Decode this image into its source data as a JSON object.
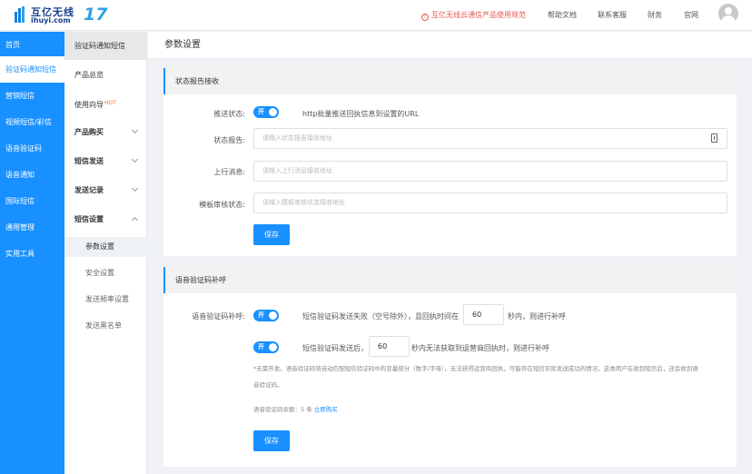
{
  "header": {
    "logo_cn": "互亿无线",
    "logo_en": "ihuyi.com",
    "logo_num": "17",
    "notice": "互亿无线云通信产品使用规范",
    "links": [
      "帮助文档",
      "联系客服",
      "财务",
      "官网"
    ]
  },
  "sidebar": {
    "items": [
      {
        "label": "首页"
      },
      {
        "label": "验证码通知短信",
        "active": true
      },
      {
        "label": "营销短信"
      },
      {
        "label": "视频短信/彩信"
      },
      {
        "label": "语音验证码"
      },
      {
        "label": "语音通知"
      },
      {
        "label": "国际短信"
      },
      {
        "label": "通用管理"
      },
      {
        "label": "实用工具"
      }
    ]
  },
  "subnav": {
    "title": "验证码通知短信",
    "items": [
      {
        "label": "产品总览"
      },
      {
        "label": "使用向导",
        "badge": "HOT"
      },
      {
        "label": "产品购买"
      },
      {
        "label": "短信发送"
      },
      {
        "label": "发送记录"
      },
      {
        "label": "短信设置"
      },
      {
        "label": "参数设置",
        "active": true
      },
      {
        "label": "安全设置"
      },
      {
        "label": "发送频率设置"
      },
      {
        "label": "发送黑名单"
      }
    ]
  },
  "page": {
    "title": "参数设置"
  },
  "status_section": {
    "title": "状态报告接收",
    "push_label": "推送状态:",
    "push_toggle": "开",
    "push_desc": "http批量推送回执信息到设置的URL",
    "report_label": "状态报告:",
    "report_placeholder": "请输入状态报告接收地址",
    "upstream_label": "上行消息:",
    "upstream_placeholder": "请输入上行消息接收地址",
    "template_label": "模板审核状态:",
    "template_placeholder": "请输入模板审核状态接收地址",
    "save": "保存"
  },
  "voice_section": {
    "title": "语音验证码补呼",
    "callback_label": "语音验证码补呼:",
    "toggle1": "开",
    "rule1_pre": "短信验证码发送失败（空号除外），且回执时间在",
    "rule1_value": "60",
    "rule1_post": "秒内，则进行补呼",
    "toggle2": "开",
    "rule2_pre": "短信验证码发送后，",
    "rule2_value": "60",
    "rule2_post": "秒内无法获取到运营商回执时，则进行补呼",
    "note_line1": "*无需开发。语音验证码将自动匹配短信验证码中的变量部分（数字/字母），无法获得运营商回执，可能存在短信实际发送成功的情况，这类用户在收到短信后，还会收到语",
    "note_line2": "音验证码。",
    "balance_label": "语音验证码余额：5 条",
    "buy_link": "立即购买",
    "save": "保存"
  }
}
